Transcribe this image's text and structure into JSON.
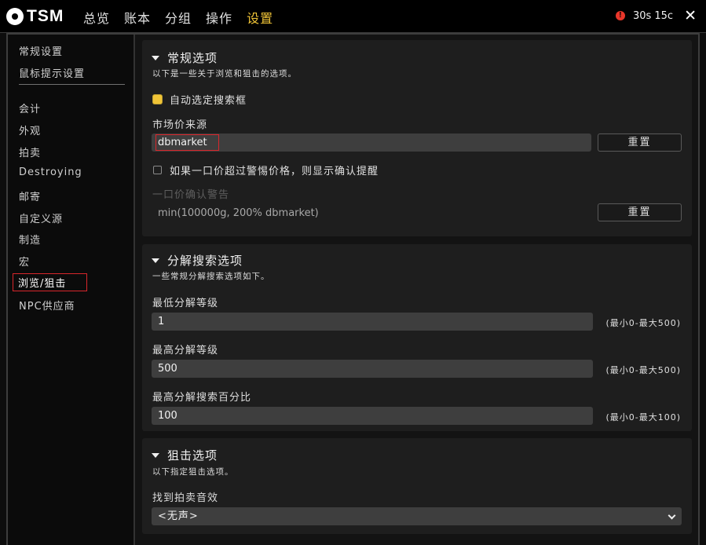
{
  "app": {
    "logo": "TSM"
  },
  "nav": {
    "items": [
      {
        "label": "总览"
      },
      {
        "label": "账本"
      },
      {
        "label": "分组"
      },
      {
        "label": "操作"
      },
      {
        "label": "设置",
        "active": true
      }
    ]
  },
  "status": {
    "timer": "30s 15c",
    "alert_symbol": "!"
  },
  "sidebar": {
    "top_items": [
      {
        "label": "常规设置"
      },
      {
        "label": "鼠标提示设置"
      }
    ],
    "items": [
      {
        "label": "会计"
      },
      {
        "label": "外观"
      },
      {
        "label": "拍卖"
      },
      {
        "label": "Destroying"
      },
      {
        "label": "邮寄"
      },
      {
        "label": "自定义源"
      },
      {
        "label": "制造"
      },
      {
        "label": "宏"
      },
      {
        "label": "浏览/狙击",
        "selected": true
      },
      {
        "label": "NPC供应商"
      }
    ]
  },
  "general": {
    "title": "常规选项",
    "desc": "以下是一些关于浏览和狙击的选项。",
    "auto_focus_label": "自动选定搜索框",
    "auto_focus_checked": true,
    "market_source_label": "市场价来源",
    "market_source_value": "dbmarket",
    "reset_label": "重置",
    "confirm_label": "如果一口价超过警惕价格，则显示确认提醒",
    "confirm_checked": false,
    "buyout_warning_label": "一口价确认警告",
    "buyout_warning_value": "min(100000g, 200% dbmarket)",
    "reset2_label": "重置"
  },
  "disenchant": {
    "title": "分解搜索选项",
    "desc": "一些常规分解搜索选项如下。",
    "min_level_label": "最低分解等级",
    "min_level_value": "1",
    "min_level_range": "(最小0-最大500)",
    "max_level_label": "最高分解等级",
    "max_level_value": "500",
    "max_level_range": "(最小0-最大500)",
    "max_pct_label": "最高分解搜索百分比",
    "max_pct_value": "100",
    "max_pct_range": "(最小0-最大100)"
  },
  "snipe": {
    "title": "狙击选项",
    "desc": "以下指定狙击选项。",
    "sound_label": "找到拍卖音效",
    "sound_value": "<无声>"
  },
  "colors": {
    "accent": "#f0c437",
    "highlight": "#d8262b",
    "alert": "#e8362a"
  }
}
